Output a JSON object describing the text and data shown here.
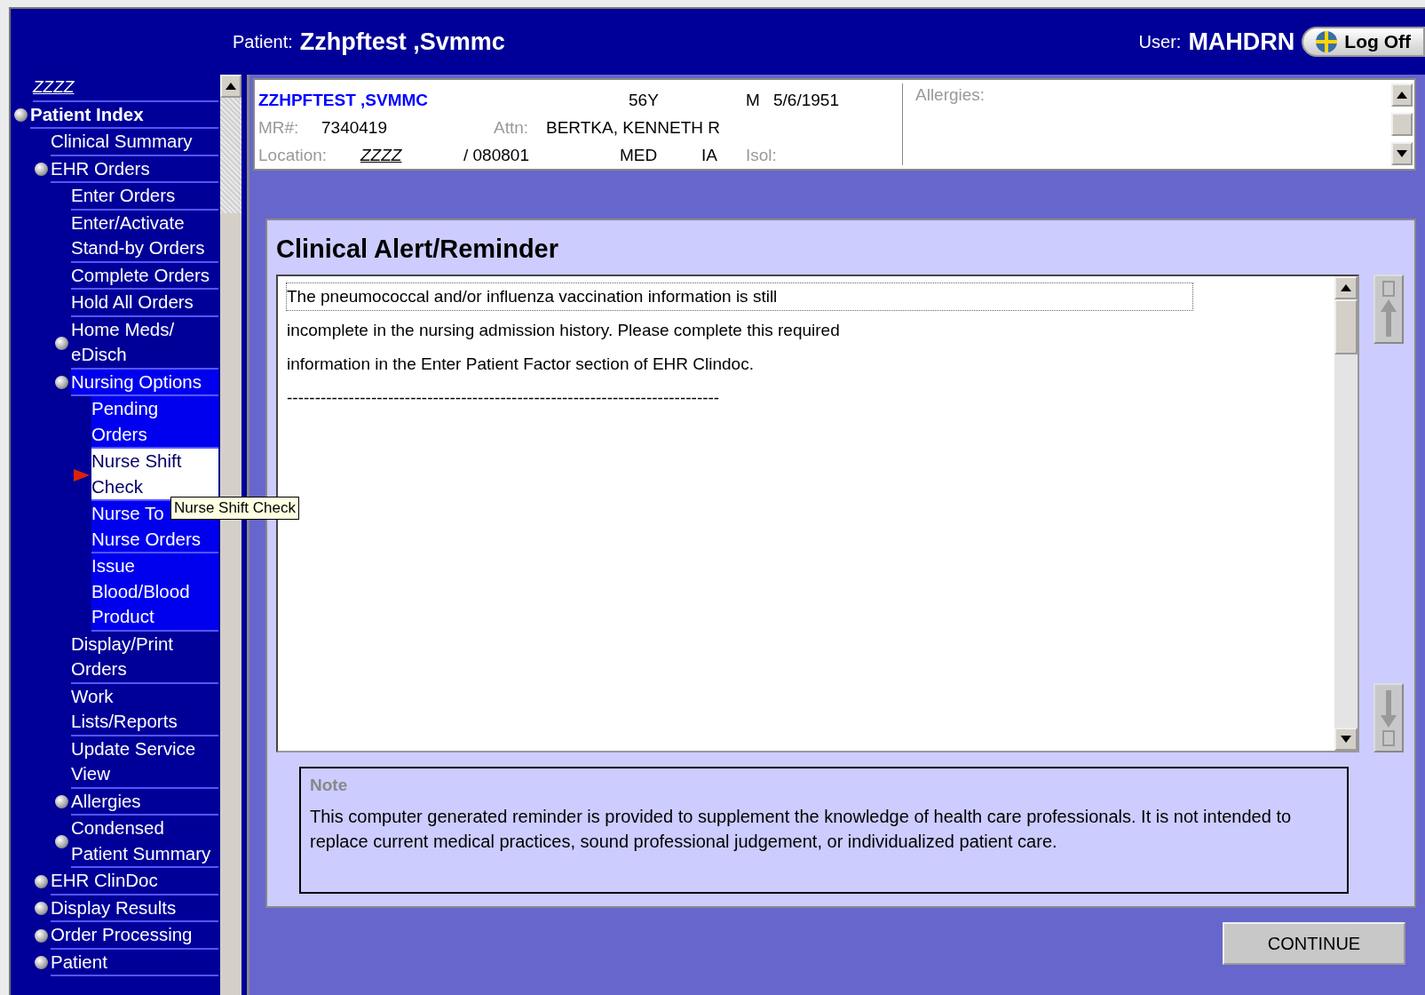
{
  "header": {
    "patient_label": "Patient:",
    "patient_name": "Zzhpftest ,Svmmc",
    "user_label": "User:",
    "user_name": "MAHDRN",
    "logoff": "Log Off"
  },
  "sidebar": {
    "location": "ZZZZ",
    "tooltip": "Nurse Shift Check",
    "items": [
      {
        "label": "Patient Index",
        "bullet": true,
        "highlighted": false,
        "selected": false,
        "children": [
          {
            "label": "Clinical Summary",
            "bullet": false,
            "highlighted": false,
            "selected": false
          },
          {
            "label": "EHR Orders",
            "bullet": true,
            "highlighted": false,
            "selected": false,
            "children": [
              {
                "label": "Enter Orders",
                "bullet": false,
                "highlighted": false,
                "selected": false
              },
              {
                "label": "Enter/Activate Stand-by Orders",
                "bullet": false,
                "highlighted": false,
                "selected": false
              },
              {
                "label": "Complete Orders",
                "bullet": false,
                "highlighted": false,
                "selected": false
              },
              {
                "label": "Hold All Orders",
                "bullet": false,
                "highlighted": false,
                "selected": false
              },
              {
                "label": "Home Meds/ eDisch",
                "bullet": true,
                "highlighted": false,
                "selected": false
              },
              {
                "label": "Nursing Options",
                "bullet": true,
                "highlighted": true,
                "selected": false,
                "children": [
                  {
                    "label": "Pending Orders",
                    "bullet": false,
                    "highlighted": true,
                    "selected": false
                  },
                  {
                    "label": "Nurse Shift Check",
                    "bullet": false,
                    "highlighted": true,
                    "selected": true
                  },
                  {
                    "label": "Nurse To Nurse Orders",
                    "bullet": false,
                    "highlighted": true,
                    "selected": false
                  },
                  {
                    "label": "Issue Blood/Blood Product",
                    "bullet": false,
                    "highlighted": true,
                    "selected": false
                  }
                ]
              },
              {
                "label": "Display/Print Orders",
                "bullet": false,
                "highlighted": false,
                "selected": false
              },
              {
                "label": "Work Lists/Reports",
                "bullet": false,
                "highlighted": false,
                "selected": false
              },
              {
                "label": "Update Service View",
                "bullet": false,
                "highlighted": false,
                "selected": false
              },
              {
                "label": "Allergies",
                "bullet": true,
                "highlighted": false,
                "selected": false
              },
              {
                "label": "Condensed Patient Summary",
                "bullet": true,
                "highlighted": false,
                "selected": false
              }
            ]
          },
          {
            "label": "EHR ClinDoc",
            "bullet": true,
            "highlighted": false,
            "selected": false
          },
          {
            "label": "Display Results",
            "bullet": true,
            "highlighted": false,
            "selected": false
          },
          {
            "label": "Order Processing",
            "bullet": true,
            "highlighted": false,
            "selected": false
          },
          {
            "label": "Patient",
            "bullet": true,
            "highlighted": false,
            "selected": false
          }
        ]
      }
    ]
  },
  "patient_banner": {
    "name": "ZZHPFTEST ,SVMMC",
    "age": "56Y",
    "sex": "M",
    "dob": "5/6/1951",
    "mr_label": "MR#:",
    "mr": "7340419",
    "attn_label": "Attn:",
    "attn": "BERTKA, KENNETH R",
    "location_label": "Location:",
    "location": "ZZZZ",
    "room": "/ 080801",
    "service": "MED",
    "type": "IA",
    "isol_label": "Isol:",
    "allergies_label": "Allergies:"
  },
  "alert": {
    "title": "Clinical Alert/Reminder",
    "lines": [
      "The pneumococcal and/or influenza vaccination information is still",
      "incomplete in the nursing admission history. Please complete this required",
      "information in the Enter Patient Factor section of EHR Clindoc.",
      "-----------------------------------------------------------------------------"
    ],
    "note_title": "Note",
    "note_text": "This computer generated reminder is provided to supplement the knowledge of health care professionals. It is not intended to replace current medical practices, sound professional judgement, or individualized patient care."
  },
  "continue_button": "CONTINUE"
}
